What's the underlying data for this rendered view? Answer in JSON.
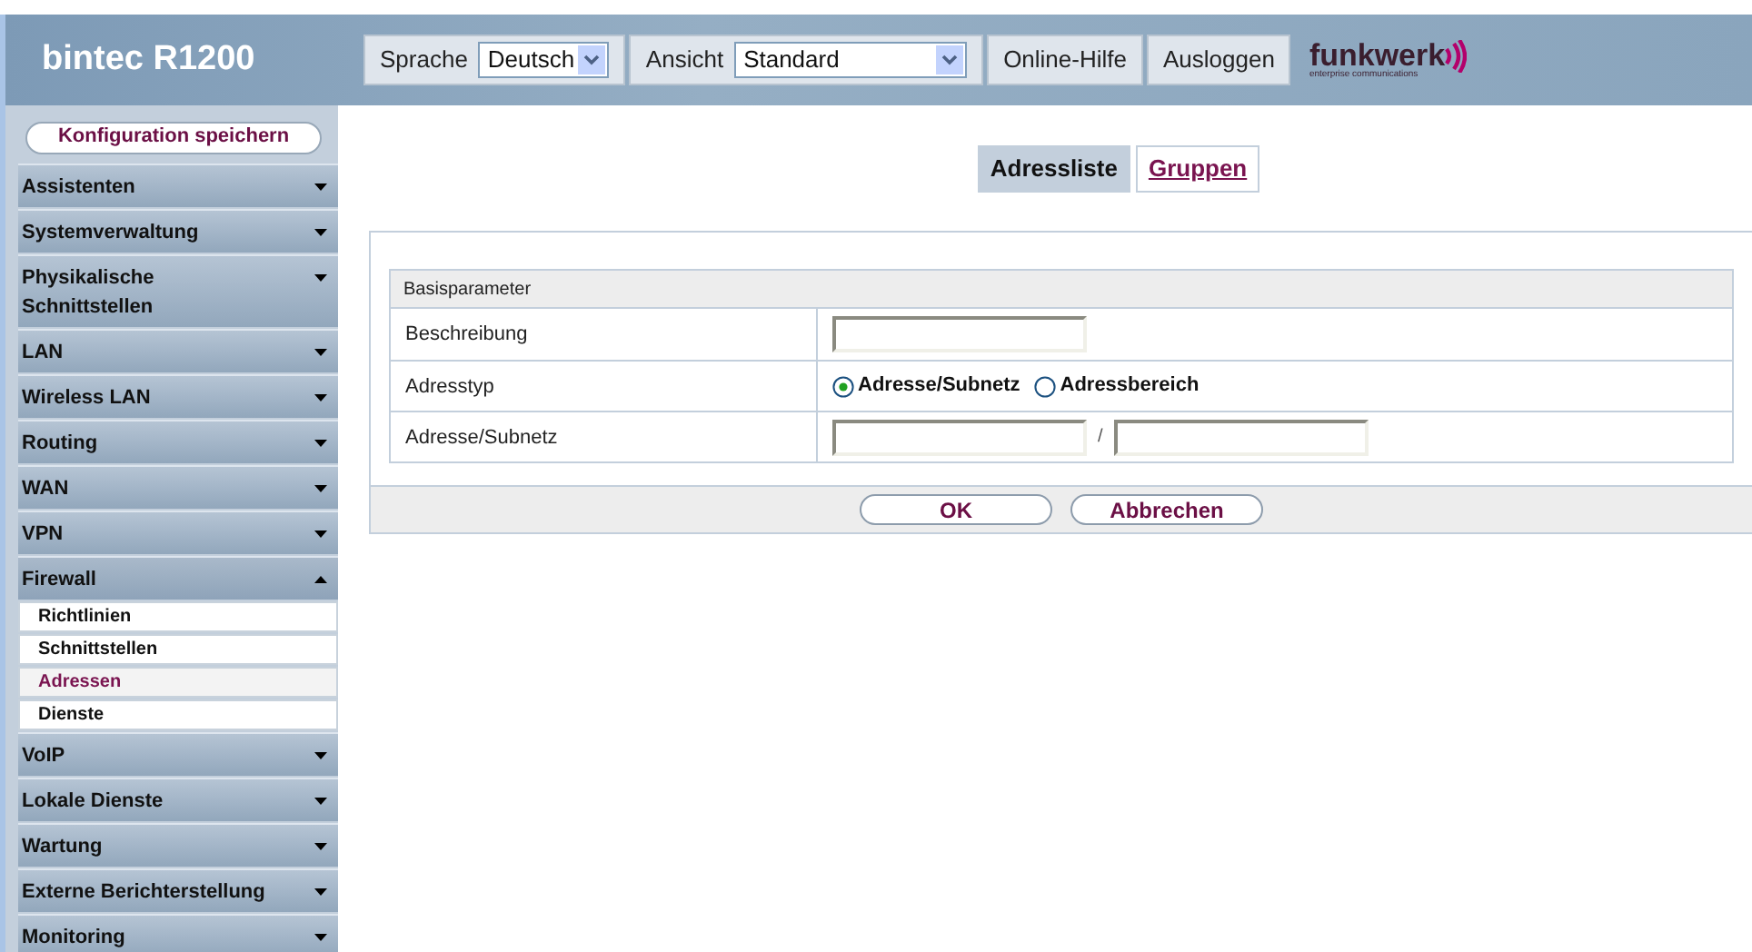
{
  "header": {
    "title": "bintec R1200",
    "language": {
      "label": "Sprache",
      "value": "Deutsch"
    },
    "view": {
      "label": "Ansicht",
      "value": "Standard"
    },
    "help": "Online-Hilfe",
    "logout": "Ausloggen",
    "logo": {
      "name": "funkwerk",
      "tagline": "enterprise communications"
    }
  },
  "sidebar": {
    "save_button": "Konfiguration speichern",
    "items": [
      {
        "label": "Assistenten",
        "expanded": false
      },
      {
        "label": "Systemverwaltung",
        "expanded": false
      },
      {
        "label": "Physikalische Schnittstellen",
        "expanded": false
      },
      {
        "label": "LAN",
        "expanded": false
      },
      {
        "label": "Wireless LAN",
        "expanded": false
      },
      {
        "label": "Routing",
        "expanded": false
      },
      {
        "label": "WAN",
        "expanded": false
      },
      {
        "label": "VPN",
        "expanded": false
      },
      {
        "label": "Firewall",
        "expanded": true,
        "children": [
          {
            "label": "Richtlinien",
            "selected": false
          },
          {
            "label": "Schnittstellen",
            "selected": false
          },
          {
            "label": "Adressen",
            "selected": true
          },
          {
            "label": "Dienste",
            "selected": false
          }
        ]
      },
      {
        "label": "VoIP",
        "expanded": false
      },
      {
        "label": "Lokale Dienste",
        "expanded": false
      },
      {
        "label": "Wartung",
        "expanded": false
      },
      {
        "label": "Externe Berichterstellung",
        "expanded": false
      },
      {
        "label": "Monitoring",
        "expanded": false
      }
    ]
  },
  "tabs": [
    {
      "label": "Adressliste",
      "selected": true
    },
    {
      "label": "Gruppen",
      "selected": false
    }
  ],
  "form": {
    "section": "Basisparameter",
    "rows": [
      {
        "kind": "text",
        "label": "Beschreibung"
      },
      {
        "kind": "radio",
        "label": "Adresstyp",
        "options": [
          {
            "label": "Adresse/Subnetz",
            "selected": true
          },
          {
            "label": "Adressbereich",
            "selected": false
          }
        ]
      },
      {
        "kind": "pair",
        "label": "Adresse/Subnetz",
        "separator": "/"
      }
    ]
  },
  "buttons": [
    "OK",
    "Abbrechen"
  ]
}
